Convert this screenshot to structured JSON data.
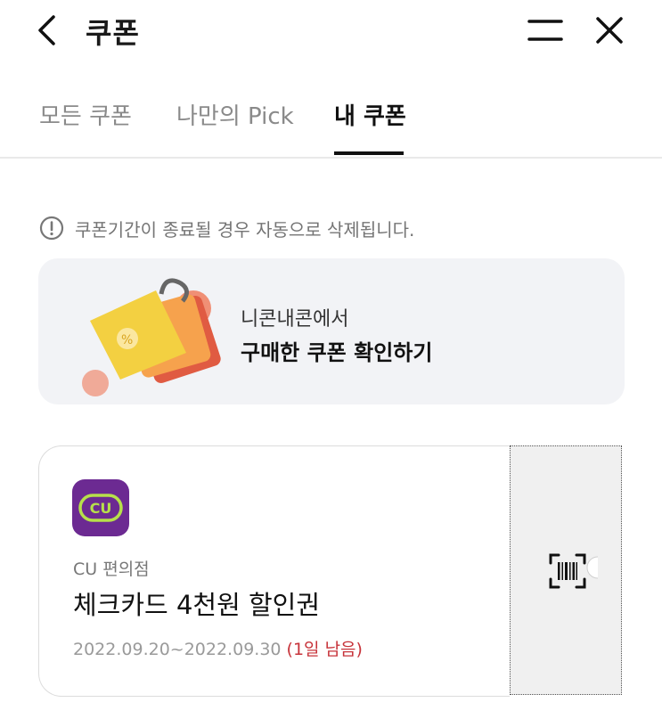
{
  "header": {
    "title": "쿠폰",
    "back_icon": "chevron-left-icon",
    "menu_icon": "menu-icon",
    "close_icon": "close-icon"
  },
  "tabs": [
    {
      "label": "모든 쿠폰",
      "active": false
    },
    {
      "label": "나만의 Pick",
      "active": false
    },
    {
      "label": "내 쿠폰",
      "active": true
    }
  ],
  "notice": {
    "icon": "exclamation-circle-icon",
    "text": "쿠폰기간이 종료될 경우 자동으로 삭제됩니다."
  },
  "banner": {
    "subtitle": "니콘내콘에서",
    "title": "구매한 쿠폰 확인하기"
  },
  "coupon": {
    "brand": "CU 편의점",
    "name": "체크카드 4천원 할인권",
    "period": "2022.09.20~2022.09.30",
    "remaining": "(1일 남음)",
    "logo_text": "CU",
    "barcode_icon": "barcode-scan-icon",
    "colors": {
      "logo_bg": "#6c2a92",
      "logo_accent": "#b7e04a",
      "remaining": "#c7333a"
    }
  }
}
